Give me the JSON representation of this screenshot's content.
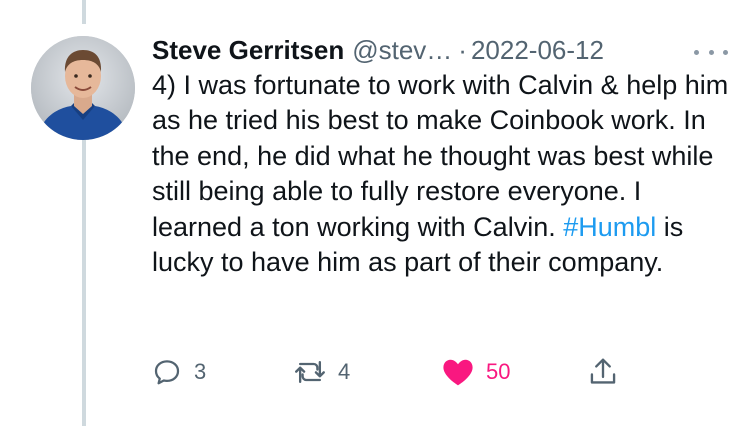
{
  "tweet": {
    "display_name": "Steve Gerritsen",
    "handle": "@stev…",
    "separator": "·",
    "date": "2022-06-12",
    "text_before_hashtag": "4) I was fortunate to work with Calvin & help him as he tried his best to make Coinbook work. In the end, he did what he thought was best while still being able to fully restore everyone. I learned a ton working with Calvin. ",
    "hashtag": "#Humbl",
    "text_after_hashtag": " is lucky to have him as part of their company."
  },
  "actions": {
    "reply_count": "3",
    "retweet_count": "4",
    "like_count": "50",
    "icons": [
      "reply-icon",
      "retweet-icon",
      "heart-icon",
      "share-icon"
    ]
  },
  "colors": {
    "hashtag": "#1d9bf0",
    "like": "#f91880",
    "secondary_text": "#536471",
    "thread_line": "#cfd9de"
  }
}
